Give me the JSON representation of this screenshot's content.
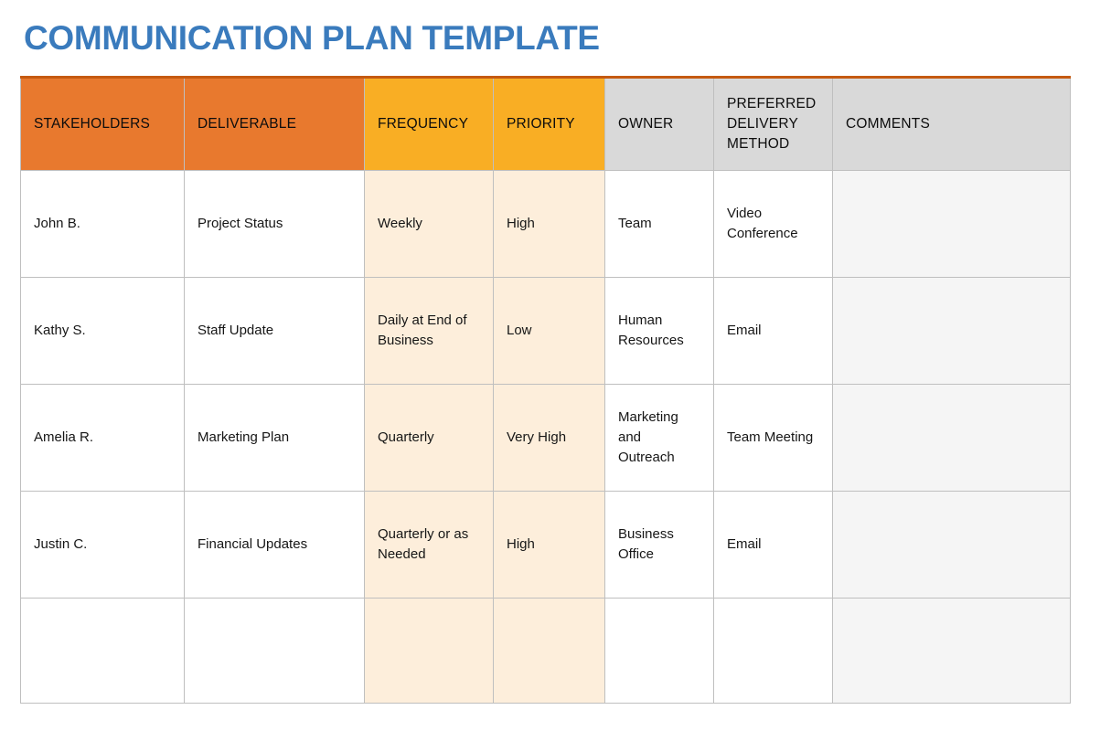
{
  "title": "COMMUNICATION PLAN TEMPLATE",
  "colors": {
    "title_blue": "#3a7bbd",
    "header_orange_dark": "#e8792e",
    "header_orange_light": "#f9ae24",
    "header_gray": "#d9d9d9",
    "cell_peach": "#fdeedb",
    "cell_gray": "#f5f5f5",
    "top_border": "#c55a11",
    "grid_line": "#bfbfbf"
  },
  "table": {
    "columns": [
      {
        "key": "stakeholders",
        "label": "STAKEHOLDERS",
        "header_style": "h-orange-dark",
        "cell_style": "c-white"
      },
      {
        "key": "deliverable",
        "label": "DELIVERABLE",
        "header_style": "h-orange-dark",
        "cell_style": "c-white"
      },
      {
        "key": "frequency",
        "label": "FREQUENCY",
        "header_style": "h-orange-light",
        "cell_style": "c-peach"
      },
      {
        "key": "priority",
        "label": "PRIORITY",
        "header_style": "h-orange-light",
        "cell_style": "c-peach"
      },
      {
        "key": "owner",
        "label": "OWNER",
        "header_style": "h-gray",
        "cell_style": "c-white"
      },
      {
        "key": "method",
        "label": "PREFERRED DELIVERY METHOD",
        "header_style": "h-gray",
        "cell_style": "c-white"
      },
      {
        "key": "comments",
        "label": "COMMENTS",
        "header_style": "h-gray",
        "cell_style": "c-gray"
      }
    ],
    "rows": [
      {
        "stakeholders": "John B.",
        "deliverable": "Project Status",
        "frequency": "Weekly",
        "priority": "High",
        "owner": "Team",
        "method": "Video Conference",
        "comments": ""
      },
      {
        "stakeholders": "Kathy S.",
        "deliverable": "Staff Update",
        "frequency": "Daily at End of Business",
        "priority": "Low",
        "owner": "Human Resources",
        "method": "Email",
        "comments": ""
      },
      {
        "stakeholders": "Amelia R.",
        "deliverable": "Marketing Plan",
        "frequency": "Quarterly",
        "priority": "Very High",
        "owner": "Marketing and Outreach",
        "method": "Team Meeting",
        "comments": ""
      },
      {
        "stakeholders": "Justin C.",
        "deliverable": "Financial Updates",
        "frequency": "Quarterly or as Needed",
        "priority": "High",
        "owner": "Business Office",
        "method": "Email",
        "comments": ""
      },
      {
        "stakeholders": "",
        "deliverable": "",
        "frequency": "",
        "priority": "",
        "owner": "",
        "method": "",
        "comments": ""
      }
    ]
  }
}
